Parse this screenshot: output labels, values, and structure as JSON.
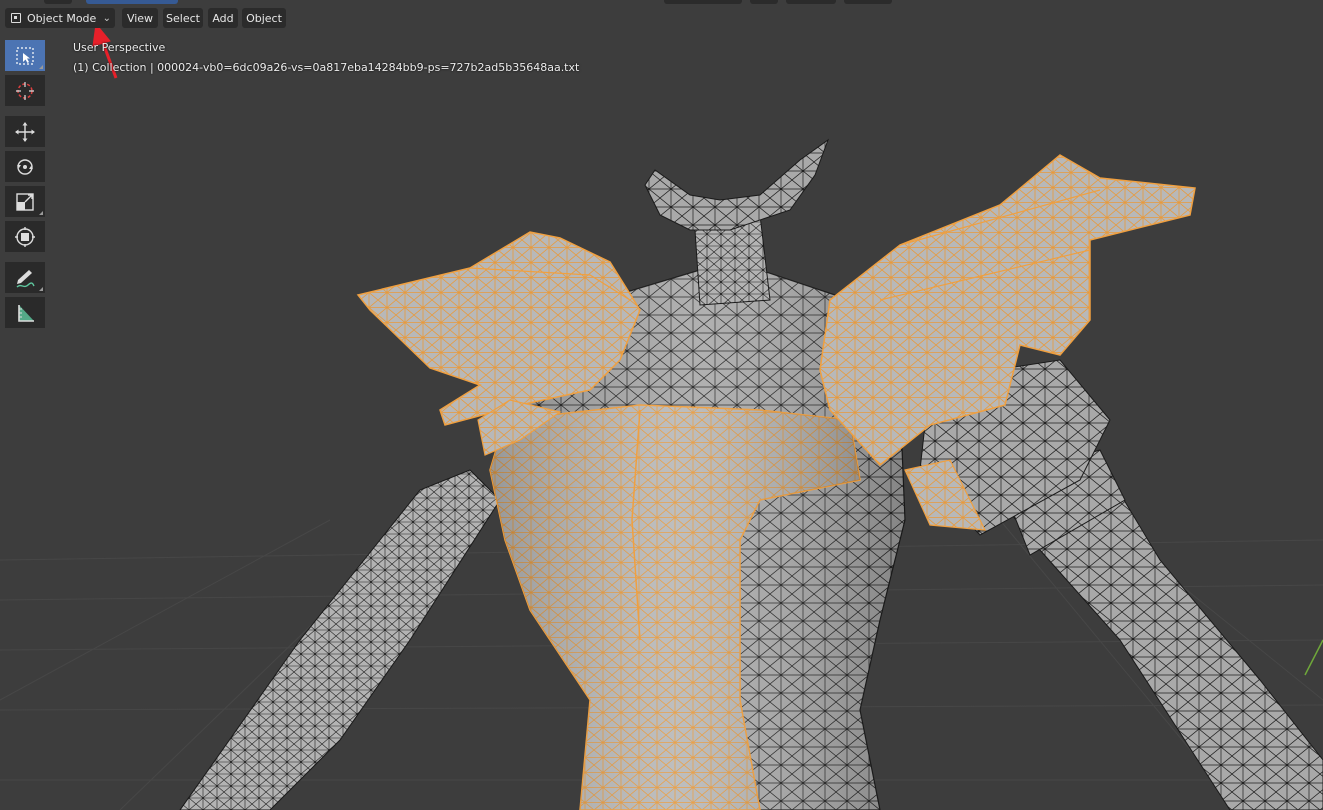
{
  "header": {
    "mode_selector": {
      "label": "Object Mode",
      "icon": "object-mode-icon"
    },
    "menus": [
      {
        "label": "View"
      },
      {
        "label": "Select"
      },
      {
        "label": "Add"
      },
      {
        "label": "Object"
      }
    ]
  },
  "viewport": {
    "view_name": "User Perspective",
    "collection_info": "(1) Collection | 000024-vb0=6dc09a26-vs=0a817eba14284bb9-ps=727b2ad5b35648aa.txt"
  },
  "toolbar": {
    "tools": [
      {
        "name": "select-box",
        "icon": "select-box-icon",
        "active": true
      },
      {
        "name": "cursor",
        "icon": "cursor-icon",
        "active": false
      },
      {
        "name": "move",
        "icon": "move-icon",
        "active": false
      },
      {
        "name": "rotate",
        "icon": "rotate-icon",
        "active": false
      },
      {
        "name": "scale",
        "icon": "scale-icon",
        "active": false
      },
      {
        "name": "transform",
        "icon": "transform-icon",
        "active": false
      },
      {
        "name": "annotate",
        "icon": "annotate-icon",
        "active": false
      },
      {
        "name": "measure",
        "icon": "measure-icon",
        "active": false
      }
    ]
  },
  "colors": {
    "background": "#3d3d3d",
    "selection_outline": "#f0a040",
    "active_tool": "#4c74b3",
    "annotation_arrow": "#e8202a"
  }
}
